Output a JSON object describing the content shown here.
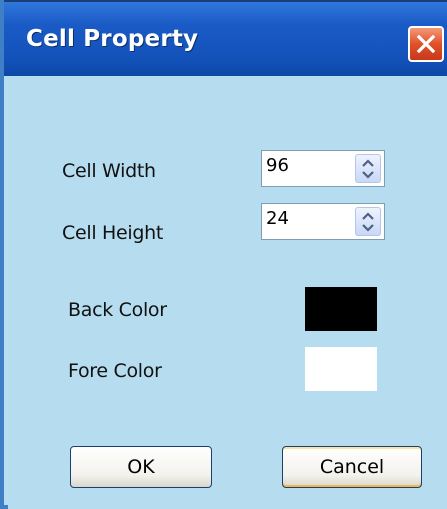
{
  "window": {
    "title": "Cell Property",
    "close_icon": "close-icon",
    "colors": {
      "titlebar": "#1251b8",
      "client": "#b5ddef",
      "close": "#e0512b"
    }
  },
  "fields": {
    "cell_width": {
      "label": "Cell Width",
      "value": "96"
    },
    "cell_height": {
      "label": "Cell Height",
      "value": "24"
    }
  },
  "colors": {
    "back": {
      "label": "Back Color",
      "value": "#000000"
    },
    "fore": {
      "label": "Fore Color",
      "value": "#ffffff"
    }
  },
  "buttons": {
    "ok": "OK",
    "cancel": "Cancel"
  }
}
